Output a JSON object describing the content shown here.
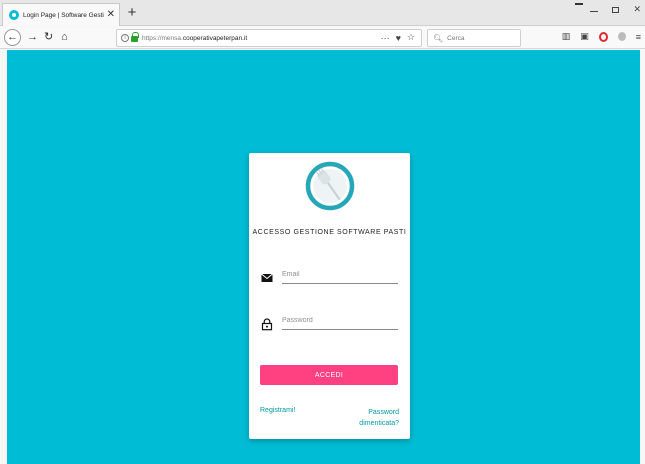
{
  "browser": {
    "tab_title": "Login Page | Software Gestione",
    "tab_close": "✕",
    "new_tab": "+",
    "url_prefix": "https://mensa.",
    "url_domain": "cooperativapeterpan.it",
    "url_more": "···",
    "search_placeholder": "Cerca",
    "icons": [
      "back-icon",
      "forward-icon",
      "reload-icon",
      "home-icon",
      "info-icon",
      "lock-icon",
      "pocket-icon",
      "bookmark-star-icon",
      "search-icon",
      "library-icon",
      "sidebar-icon",
      "opera-icon",
      "extension-icon",
      "menu-icon"
    ]
  },
  "login": {
    "title": "ACCESSO GESTIONE SOFTWARE PASTI",
    "email_placeholder": "Email",
    "password_placeholder": "Password",
    "submit_label": "ACCEDI",
    "register_link": "Registrami!",
    "forgot_link_line1": "Password",
    "forgot_link_line2": "dimenticata?"
  },
  "colors": {
    "background": "#00bcd4",
    "button": "#ff4081",
    "link": "#0097a7",
    "logo_ring": "#26a7b8"
  }
}
